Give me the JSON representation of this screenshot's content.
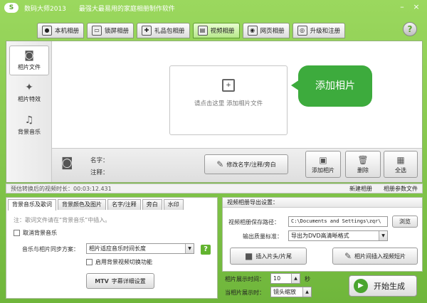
{
  "app": {
    "logo": "S",
    "title": "数码大师2013",
    "slogan": "最强大最易用的家庭相册制作软件",
    "minimize": "–",
    "close": "×"
  },
  "tabs": [
    {
      "label": "本机相册",
      "icon": "person-icon"
    },
    {
      "label": "锁屏相册",
      "icon": "monitor-icon"
    },
    {
      "label": "礼品包相册",
      "icon": "gift-icon"
    },
    {
      "label": "视频相册",
      "icon": "film-icon",
      "active": true
    },
    {
      "label": "网页相册",
      "icon": "globe-icon"
    },
    {
      "label": "升级和注册",
      "icon": "upgrade-icon"
    }
  ],
  "help": "?",
  "sidebar": [
    {
      "label": "相片文件",
      "icon": "camera-icon",
      "active": true
    },
    {
      "label": "相片特效",
      "icon": "effects-icon"
    },
    {
      "label": "背景音乐",
      "icon": "music-icon"
    }
  ],
  "dropzone": {
    "text": "请点击这里 添加相片文件"
  },
  "bubble": "添加相片",
  "info": {
    "name_label": "名字：",
    "note_label": "注释："
  },
  "buttons": {
    "edit": "修改名字/注释/旁白",
    "add": "添加相片",
    "delete": "删除",
    "selectall": "全选"
  },
  "status": {
    "estimate": "预估转换后的视频时长：00:03:12.431",
    "new_album": "新建相册",
    "album_params": "相册参数文件"
  },
  "left_tabs": [
    "背景音乐及歌词",
    "背景颜色及图片",
    "名字/注释",
    "旁白",
    "水印"
  ],
  "left": {
    "note": "注：歌词文件请在“背景音乐”中插入。",
    "cancel_bg": "取消背景音乐",
    "sync_label": "音乐与相片同步方案：",
    "sync_value": "相片适应音乐时间长度",
    "switch_label": "启用背景视频切换功能",
    "mtv_label": "MTV",
    "subtitle_btn": "字幕详细设置"
  },
  "right": {
    "title": "视频相册导出设置：",
    "path_label": "视频相册保存路径：",
    "path_value": "C:\\Documents and Settings\\zqr\\",
    "browse": "浏览",
    "quality_label": "输出质量标准：",
    "quality_value": "导出为DVD高清晰格式",
    "insert_head": "插入片头/片尾",
    "insert_clip": "相片间插入视频短片"
  },
  "bottom": {
    "show_time_label": "相片展示时间：",
    "show_time_value": "10",
    "show_time_unit": "秒",
    "show_mode_label": "当相片展示时：",
    "show_mode_value": "镜头缩放",
    "start": "开始生成"
  }
}
